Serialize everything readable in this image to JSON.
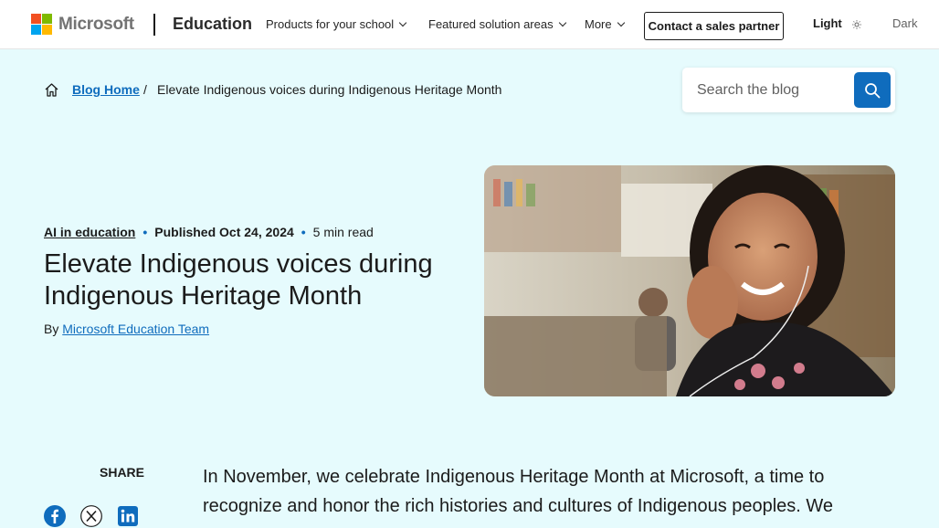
{
  "header": {
    "logo_text": "Microsoft",
    "brand": "Education",
    "nav": [
      {
        "label": "Products for your school"
      },
      {
        "label": "Featured solution areas"
      },
      {
        "label": "More"
      }
    ],
    "cta_label": "Contact a sales partner",
    "theme_light": "Light",
    "theme_dark": "Dark"
  },
  "breadcrumb": {
    "home_icon": "home-icon",
    "link": "Blog Home",
    "separator": "/",
    "current": "Elevate Indigenous voices during Indigenous Heritage Month"
  },
  "search": {
    "placeholder": "Search the blog",
    "value": ""
  },
  "article": {
    "category": "AI in education",
    "published": "Published Oct 24, 2024",
    "read_time": "5 min read",
    "title": "Elevate Indigenous voices during Indigenous Heritage Month",
    "by": "By",
    "author": "Microsoft Education Team",
    "intro": "In November, we celebrate Indigenous Heritage Month at Microsoft, a time to recognize and honor the rich histories and cultures of Indigenous peoples. We"
  },
  "share": {
    "label": "SHARE",
    "icons": [
      "facebook-icon",
      "x-icon",
      "linkedin-icon"
    ]
  },
  "colors": {
    "background": "#e6fbfd",
    "accent": "#0f6cbd",
    "ms_red": "#f25022",
    "ms_green": "#7fba00",
    "ms_blue": "#00a4ef",
    "ms_yellow": "#ffb900"
  }
}
